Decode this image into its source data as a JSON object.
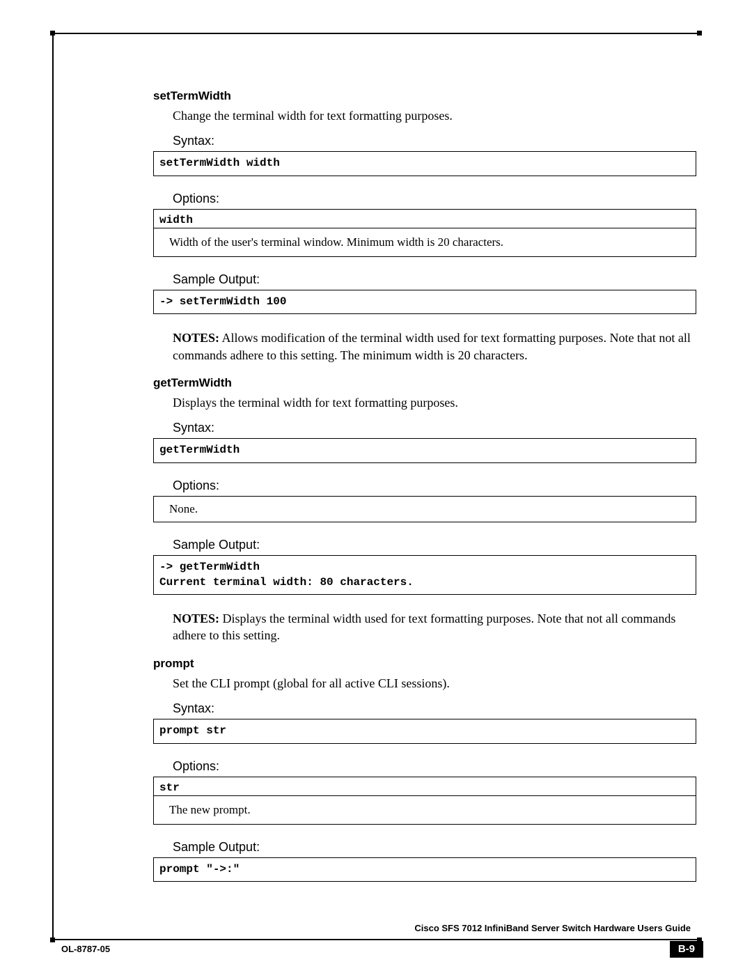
{
  "footer": {
    "book_title": "Cisco SFS 7012 InfiniBand Server Switch Hardware Users Guide",
    "doc_id": "OL-8787-05",
    "page_num": "B-9"
  },
  "sections": [
    {
      "title": "setTermWidth",
      "desc": "Change the terminal width for text formatting purposes.",
      "labels": {
        "syntax": "Syntax:",
        "options": "Options:",
        "sample": "Sample Output:"
      },
      "syntax_box": "setTermWidth width",
      "option_head": "width",
      "option_body": "Width of the user's terminal window. Minimum width is 20 characters.",
      "sample_box": "-> setTermWidth 100",
      "notes_label": "NOTES:",
      "notes": "Allows modification of the terminal width used for text formatting purposes. Note that not all commands adhere to this setting.  The minimum width is 20 characters."
    },
    {
      "title": "getTermWidth",
      "desc": "Displays the terminal width for text formatting purposes.",
      "labels": {
        "syntax": "Syntax:",
        "options": "Options:",
        "sample": "Sample Output:"
      },
      "syntax_box": "getTermWidth",
      "option_body_plain": "None.",
      "sample_box": "-> getTermWidth\nCurrent terminal width: 80 characters.",
      "notes_label": "NOTES:",
      "notes": "Displays the terminal width used for text formatting purposes.  Note that not all commands adhere to this setting."
    },
    {
      "title": "prompt",
      "desc": "Set the CLI prompt (global for all active CLI sessions).",
      "labels": {
        "syntax": "Syntax:",
        "options": "Options:",
        "sample": "Sample Output:"
      },
      "syntax_box": "prompt str",
      "option_head": "str",
      "option_body": "The new prompt.",
      "sample_box": "prompt \"->:\""
    }
  ]
}
